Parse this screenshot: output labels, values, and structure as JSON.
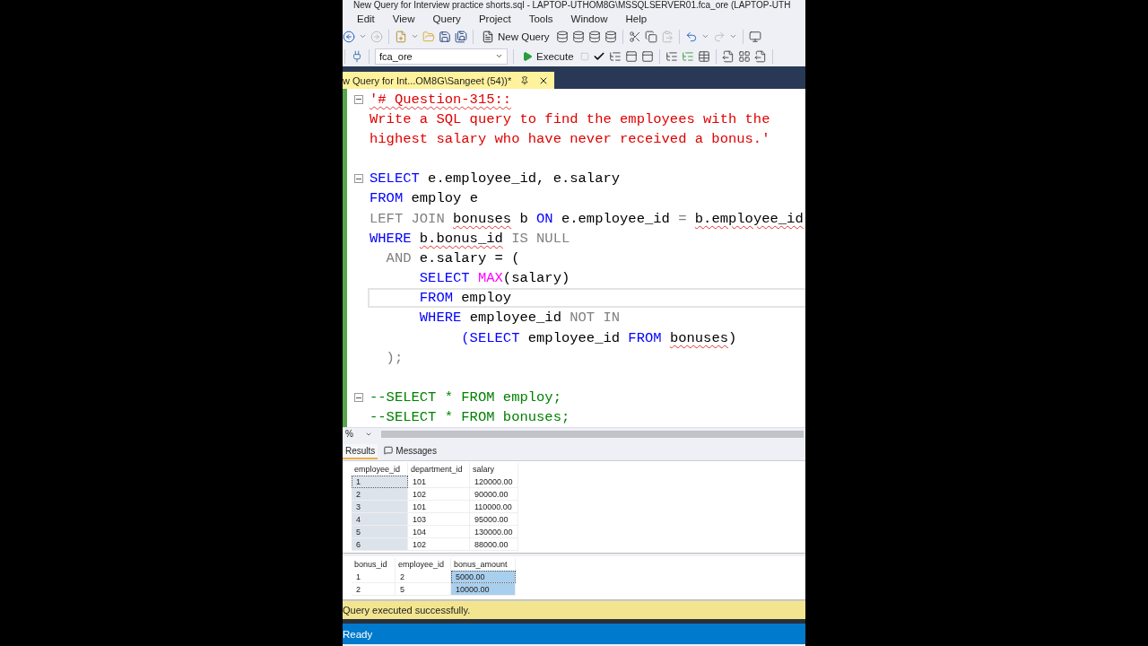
{
  "title_bar": {
    "title": "New Query for Interview practice shorts.sql - LAPTOP-UTHOM8G\\MSSQLSERVER01.fca_ore (LAPTOP-UTH"
  },
  "menu": [
    "Edit",
    "View",
    "Query",
    "Project",
    "Tools",
    "Window",
    "Help"
  ],
  "toolbar": {
    "new_query": "New Query",
    "database": "fca_ore",
    "execute": "Execute"
  },
  "document_tab": {
    "title": "w Query for Int...OM8G\\Sangeet (54))*",
    "selected": true
  },
  "editor": {
    "lines": [
      {
        "fold": true,
        "current": false,
        "tokens": [
          {
            "t": "'# Question-315::",
            "kind": "string",
            "squiggle": true
          }
        ]
      },
      {
        "fold": false,
        "current": false,
        "tokens": [
          {
            "t": "Write a SQL query to find the employees with the",
            "kind": "string"
          }
        ]
      },
      {
        "fold": false,
        "current": false,
        "tokens": [
          {
            "t": "highest salary who have never received a bonus.'",
            "kind": "string"
          }
        ]
      },
      {
        "fold": false,
        "current": false
      },
      {
        "fold": true,
        "current": false,
        "tokens": [
          {
            "t": "SELECT",
            "kind": "keyword"
          },
          {
            "t": " e.employee_id, e.salary",
            "kind": "plain"
          }
        ]
      },
      {
        "fold": false,
        "current": false,
        "tokens": [
          {
            "t": "FROM",
            "kind": "keyword"
          },
          {
            "t": " employ e",
            "kind": "plain"
          }
        ]
      },
      {
        "fold": false,
        "current": false,
        "tokens": [
          {
            "t": "LEFT JOIN ",
            "kind": "operator"
          },
          {
            "t": "bonuses",
            "kind": "plain",
            "squiggle": true
          },
          {
            "t": " b ",
            "kind": "plain"
          },
          {
            "t": "ON",
            "kind": "keyword"
          },
          {
            "t": " e.employee_id ",
            "kind": "plain"
          },
          {
            "t": "= ",
            "kind": "operator"
          },
          {
            "t": "b.employee_id",
            "kind": "plain",
            "squiggle": true
          }
        ]
      },
      {
        "fold": false,
        "current": false,
        "tokens": [
          {
            "t": "WHERE ",
            "kind": "keyword"
          },
          {
            "t": "b.bonus_id",
            "kind": "plain",
            "squiggle": true
          },
          {
            "t": " IS NULL",
            "kind": "operator"
          }
        ]
      },
      {
        "fold": false,
        "current": false,
        "tokens": [
          {
            "t": "  AND",
            "kind": "operator"
          },
          {
            "t": " e.salary = (",
            "kind": "plain"
          }
        ]
      },
      {
        "fold": false,
        "current": false,
        "tokens": [
          {
            "t": "      SELECT ",
            "kind": "keyword"
          },
          {
            "t": "MAX",
            "kind": "function"
          },
          {
            "t": "(salary)",
            "kind": "plain"
          }
        ]
      },
      {
        "fold": false,
        "current": true,
        "tokens": [
          {
            "t": "      FROM",
            "kind": "keyword"
          },
          {
            "t": " employ",
            "kind": "plain"
          }
        ]
      },
      {
        "fold": false,
        "current": false,
        "tokens": [
          {
            "t": "      WHERE",
            "kind": "keyword"
          },
          {
            "t": " employee_id ",
            "kind": "plain"
          },
          {
            "t": "NOT IN",
            "kind": "operator"
          }
        ]
      },
      {
        "fold": false,
        "current": false,
        "tokens": [
          {
            "t": "           (SELECT",
            "kind": "keyword"
          },
          {
            "t": " employee_id ",
            "kind": "plain"
          },
          {
            "t": "FROM ",
            "kind": "keyword"
          },
          {
            "t": "bonuses",
            "kind": "plain",
            "squiggle": true
          },
          {
            "t": ")",
            "kind": "plain"
          }
        ]
      },
      {
        "fold": false,
        "current": false,
        "tokens": [
          {
            "t": "  );",
            "kind": "operator"
          }
        ]
      },
      {
        "fold": false,
        "current": false
      },
      {
        "fold": true,
        "current": false,
        "tokens": [
          {
            "t": "--SELECT * FROM employ;",
            "kind": "comment"
          }
        ]
      },
      {
        "fold": false,
        "current": false,
        "tokens": [
          {
            "t": "--SELECT * FROM bonuses;",
            "kind": "comment"
          }
        ]
      }
    ]
  },
  "zoom": "%",
  "results_tabs": [
    {
      "label": "Results",
      "selected": true
    },
    {
      "label": "Messages",
      "selected": false
    }
  ],
  "grids": [
    {
      "active": false,
      "columns": [
        {
          "name": "employee_id",
          "selected": true
        },
        {
          "name": "department_id",
          "selected": false
        },
        {
          "name": "salary",
          "selected": false
        }
      ],
      "rows": [
        [
          "1",
          "101",
          "120000.00"
        ],
        [
          "2",
          "102",
          "90000.00"
        ],
        [
          "3",
          "101",
          "110000.00"
        ],
        [
          "4",
          "103",
          "95000.00"
        ],
        [
          "5",
          "104",
          "130000.00"
        ],
        [
          "6",
          "102",
          "88000.00"
        ]
      ]
    },
    {
      "active": true,
      "columns": [
        {
          "name": "bonus_id",
          "selected": false
        },
        {
          "name": "employee_id",
          "selected": false
        },
        {
          "name": "bonus_amount",
          "selected": true
        }
      ],
      "rows": [
        [
          "1",
          "2",
          "5000.00"
        ],
        [
          "2",
          "5",
          "10000.00"
        ]
      ]
    }
  ],
  "message": "Query executed successfully.",
  "status": "Ready"
}
